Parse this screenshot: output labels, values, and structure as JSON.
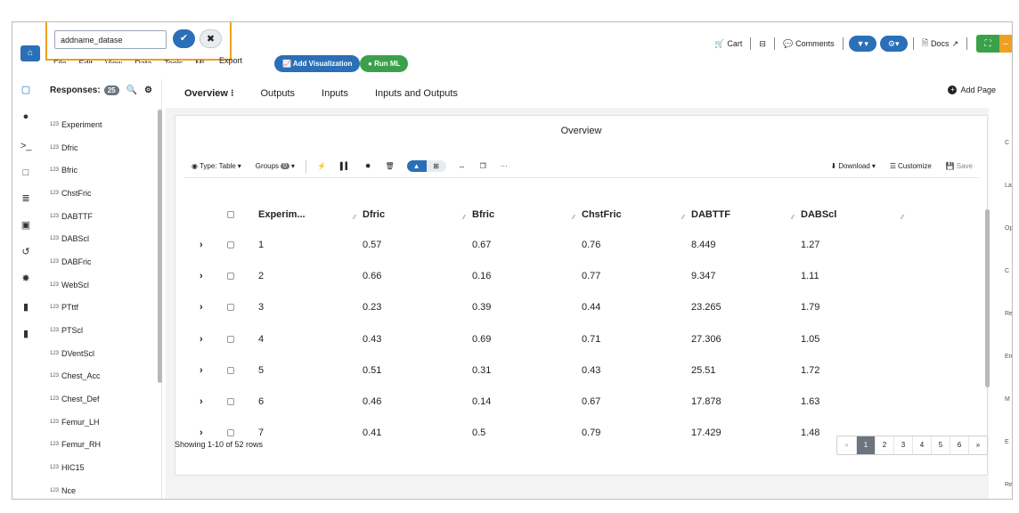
{
  "rename": {
    "value": "addname_datase",
    "confirm_icon": "check-icon",
    "cancel_icon": "close-icon"
  },
  "menu": {
    "items": [
      "File",
      "Edit",
      "View",
      "Data",
      "Tools",
      "ML",
      "Export"
    ]
  },
  "actions": {
    "add_visualization": "Add Visualization",
    "run_ml": "Run ML"
  },
  "header_right": {
    "cart": "Cart",
    "comments": "Comments",
    "docs": "Docs"
  },
  "responses": {
    "label": "Responses:",
    "count": "25",
    "prefix": "123",
    "items": [
      "Experiment",
      "Dfric",
      "Bfric",
      "ChstFric",
      "DABTTF",
      "DABScl",
      "DABFric",
      "WebScl",
      "PTttf",
      "PTScl",
      "DVentScl",
      "Chest_Acc",
      "Chest_Def",
      "Femur_LH",
      "Femur_RH",
      "HIC15",
      "Nce"
    ]
  },
  "tabs": [
    "Overview",
    "Outputs",
    "Inputs",
    "Inputs and Outputs"
  ],
  "add_page": "Add Page",
  "card": {
    "title": "Overview"
  },
  "toolbar": {
    "type_label": "Type: Table",
    "groups_label": "Groups",
    "groups_count": "0",
    "download": "Download",
    "customize": "Customize",
    "save": "Save"
  },
  "table": {
    "columns": [
      "Experim...",
      "Dfric",
      "Bfric",
      "ChstFric",
      "DABTTF",
      "DABScl"
    ],
    "rows": [
      [
        "1",
        "0.57",
        "0.67",
        "0.76",
        "8.449",
        "1.27"
      ],
      [
        "2",
        "0.66",
        "0.16",
        "0.77",
        "9.347",
        "1.11"
      ],
      [
        "3",
        "0.23",
        "0.39",
        "0.44",
        "23.265",
        "1.79"
      ],
      [
        "4",
        "0.43",
        "0.69",
        "0.71",
        "27.306",
        "1.05"
      ],
      [
        "5",
        "0.51",
        "0.31",
        "0.43",
        "25.51",
        "1.72"
      ],
      [
        "6",
        "0.46",
        "0.14",
        "0.67",
        "17.878",
        "1.63"
      ],
      [
        "7",
        "0.41",
        "0.5",
        "0.79",
        "17.429",
        "1.48"
      ]
    ]
  },
  "pagination": {
    "showing": "Showing 1-10 of 52 rows",
    "prev": "«",
    "pages": [
      "1",
      "2",
      "3",
      "4",
      "5",
      "6"
    ],
    "next": "»",
    "current": "1"
  },
  "right_edge": [
    "C",
    "La",
    "Op",
    "C",
    "Re",
    "En",
    "M",
    "E",
    "Re"
  ]
}
